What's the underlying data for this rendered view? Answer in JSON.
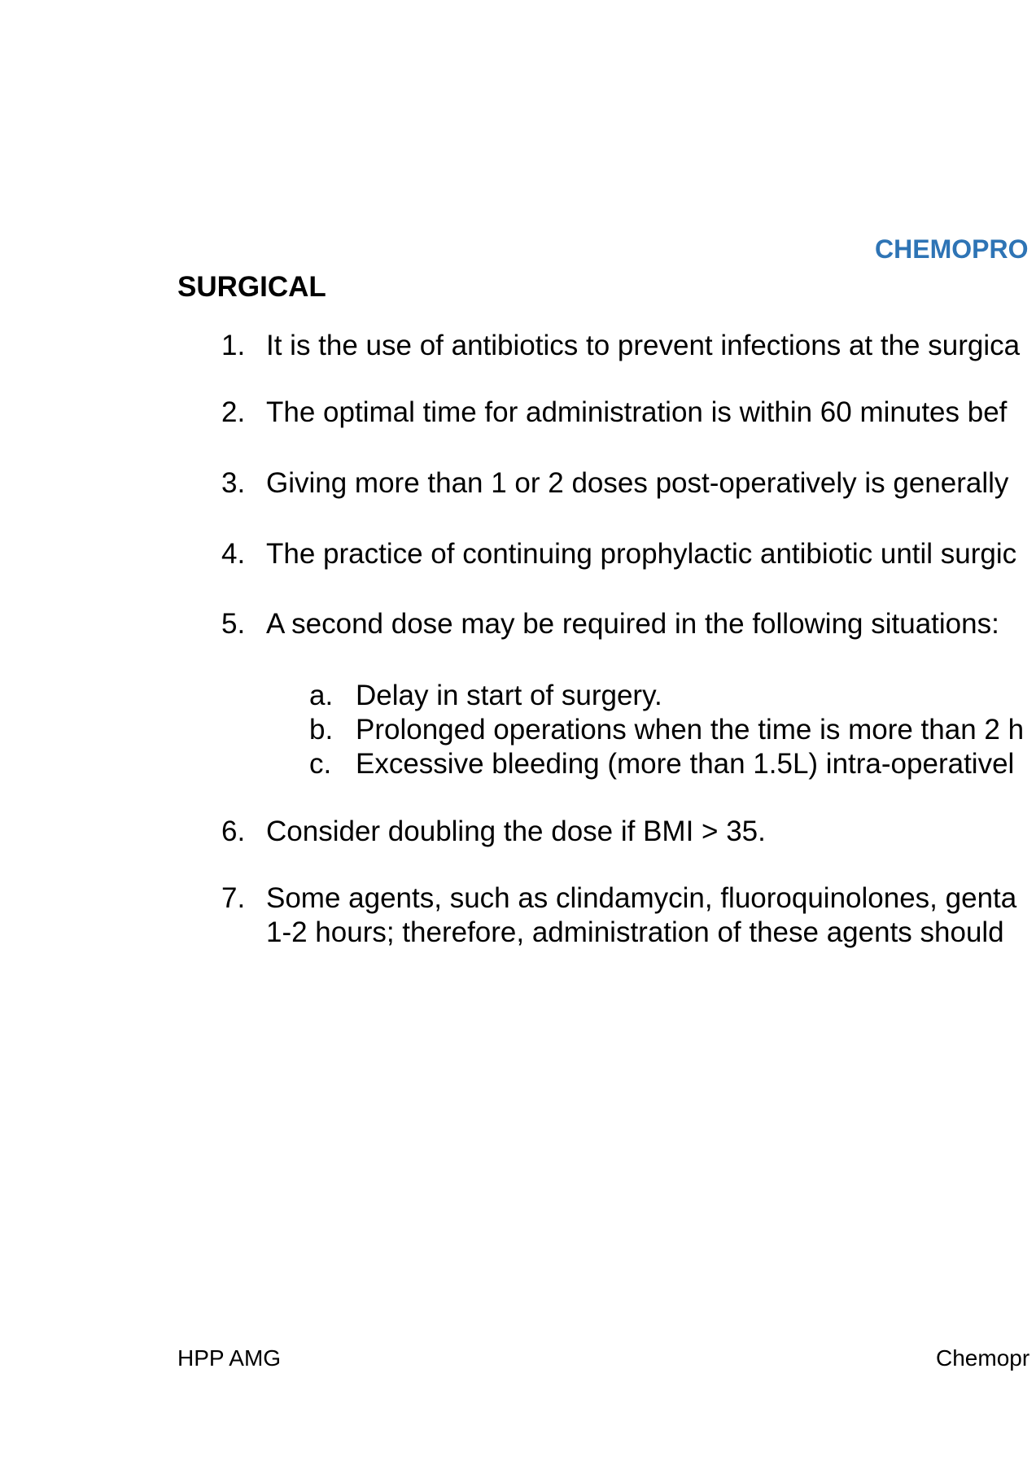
{
  "header": {
    "title": "CHEMOPRO",
    "title_color": "#2E74B5"
  },
  "section": {
    "heading": "SURGICAL"
  },
  "items": [
    {
      "num": "1.",
      "text": "It is the use of antibiotics to prevent infections at the surgica"
    },
    {
      "num": "2.",
      "text": "The optimal time for administration is within 60 minutes bef"
    },
    {
      "num": "3.",
      "text": "Giving more than 1 or 2 doses post-operatively is generally"
    },
    {
      "num": "4.",
      "text": "The practice of continuing prophylactic antibiotic until surgic"
    },
    {
      "num": "5.",
      "text": "A second dose may be required in the following situations:"
    },
    {
      "num": "6.",
      "text": "Consider doubling the dose if BMI > 35."
    },
    {
      "num": "7.",
      "text": "Some agents, such as clindamycin, fluoroquinolones, genta",
      "cont": "1-2 hours; therefore, administration of these agents should"
    }
  ],
  "subitems": [
    {
      "letter": "a.",
      "text": "Delay in start of surgery."
    },
    {
      "letter": "b.",
      "text": "Prolonged operations when the time is more than 2 h"
    },
    {
      "letter": "c.",
      "text": "Excessive bleeding (more than 1.5L) intra-operativel"
    }
  ],
  "footer": {
    "left": "HPP AMG",
    "right": "Chemopr"
  }
}
